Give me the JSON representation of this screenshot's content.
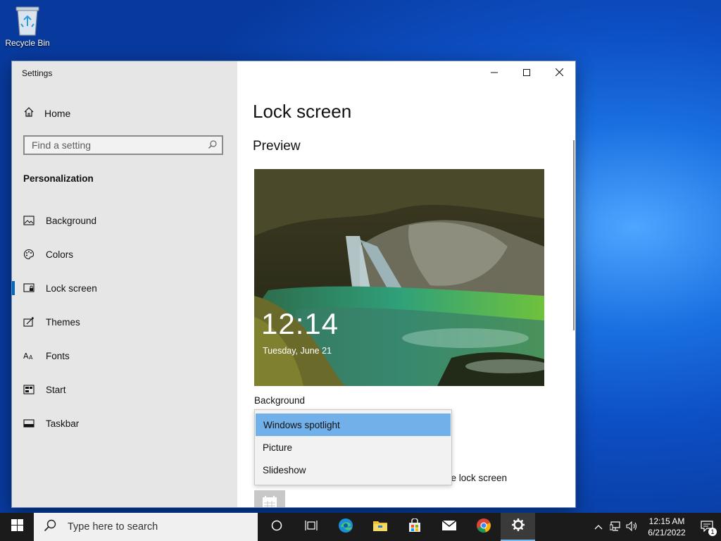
{
  "desktop": {
    "recycle_bin_label": "Recycle Bin"
  },
  "window": {
    "title": "Settings",
    "controls": {
      "minimize": "minimize-icon",
      "maximize": "maximize-icon",
      "close": "close-icon"
    }
  },
  "sidebar": {
    "home_label": "Home",
    "search": {
      "placeholder": "Find a setting",
      "value": ""
    },
    "section_title": "Personalization",
    "items": [
      {
        "label": "Background",
        "icon": "picture-icon",
        "active": false
      },
      {
        "label": "Colors",
        "icon": "palette-icon",
        "active": false
      },
      {
        "label": "Lock screen",
        "icon": "lock-screen-icon",
        "active": true
      },
      {
        "label": "Themes",
        "icon": "themes-icon",
        "active": false
      },
      {
        "label": "Fonts",
        "icon": "fonts-icon",
        "active": false
      },
      {
        "label": "Start",
        "icon": "start-icon",
        "active": false
      },
      {
        "label": "Taskbar",
        "icon": "taskbar-icon",
        "active": false
      }
    ]
  },
  "content": {
    "title": "Lock screen",
    "preview_heading": "Preview",
    "preview": {
      "time": "12:14",
      "date": "Tuesday, June 21"
    },
    "background_label": "Background",
    "dropdown_options": [
      {
        "label": "Windows spotlight",
        "selected": true
      },
      {
        "label": "Picture",
        "selected": false
      },
      {
        "label": "Slideshow",
        "selected": false
      }
    ],
    "partial_text": "he lock screen"
  },
  "taskbar": {
    "search_placeholder": "Type here to search",
    "apps": [
      "cortana-icon",
      "task-view-icon",
      "edge-icon",
      "file-explorer-icon",
      "store-icon",
      "mail-icon",
      "chrome-icon",
      "settings-icon"
    ],
    "clock": {
      "time": "12:15 AM",
      "date": "6/21/2022"
    },
    "notification_count": "1"
  },
  "colors": {
    "accent": "#0067c0",
    "dropdown_selected": "#72b0ea",
    "taskbar": "#1b1b1b"
  }
}
